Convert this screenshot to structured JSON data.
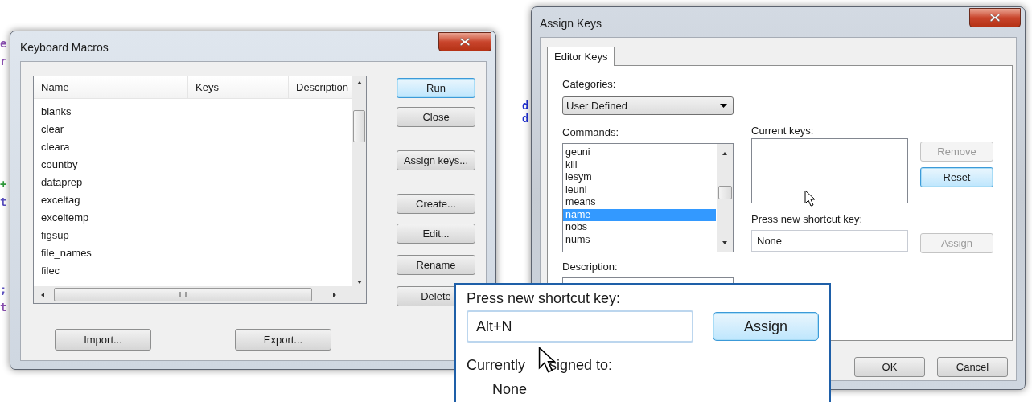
{
  "editor_fragments": [
    {
      "text": "e",
      "color": "#8a4fb0"
    },
    {
      "text": "r",
      "color": "#8a4fb0"
    },
    {
      "text": "+",
      "color": "#2e9a3a"
    },
    {
      "text": "t",
      "color": "#5a4fc0"
    },
    {
      "text": ";",
      "color": "#5a4fc0"
    },
    {
      "text": "t",
      "color": "#8a4fb0"
    },
    {
      "text": "d",
      "color": "#1f2fd0"
    },
    {
      "text": "d",
      "color": "#1f2fd0"
    }
  ],
  "keyboard_macros": {
    "title": "Keyboard Macros",
    "columns": [
      "Name",
      "Keys",
      "Description"
    ],
    "rows": [
      "blanks",
      "clear",
      "cleara",
      "countby",
      "dataprep",
      "exceltag",
      "exceltemp",
      "figsup",
      "file_names",
      "filec"
    ],
    "buttons": [
      {
        "label": "Run",
        "default": true
      },
      {
        "label": "Close",
        "default": false
      },
      {
        "label": "Assign keys...",
        "default": false
      },
      {
        "label": "Create...",
        "default": false
      },
      {
        "label": "Edit...",
        "default": false
      },
      {
        "label": "Rename",
        "default": false
      },
      {
        "label": "Delete",
        "default": false
      }
    ],
    "bottom_buttons": [
      {
        "label": "Import..."
      },
      {
        "label": "Export..."
      }
    ]
  },
  "assign_keys": {
    "title": "Assign Keys",
    "tabs": [
      {
        "label": "Editor Keys",
        "selected": true
      }
    ],
    "categories": {
      "label": "Categories:",
      "value": "User Defined"
    },
    "commands": {
      "label": "Commands:",
      "items": [
        {
          "label": "geuni",
          "selected": false
        },
        {
          "label": "kill",
          "selected": false
        },
        {
          "label": "lesym",
          "selected": false
        },
        {
          "label": "leuni",
          "selected": false
        },
        {
          "label": "means",
          "selected": false
        },
        {
          "label": "name",
          "selected": true
        },
        {
          "label": "nobs",
          "selected": false
        },
        {
          "label": "nums",
          "selected": false
        }
      ]
    },
    "description": {
      "label": "Description:"
    },
    "current_keys": {
      "label": "Current keys:"
    },
    "side_buttons": [
      {
        "label": "Remove",
        "disabled": true,
        "default": false
      },
      {
        "label": "Reset",
        "disabled": false,
        "default": true
      }
    ],
    "shortcut": {
      "label": "Press new shortcut key:",
      "value": "None"
    },
    "assign_button": {
      "label": "Assign",
      "disabled": true
    },
    "footer_buttons": [
      "OK",
      "Cancel"
    ]
  },
  "zoom_inset": {
    "shortcut_label": "Press new shortcut key:",
    "shortcut_value": "Alt+N",
    "assign_button": {
      "label": "Assign",
      "highlighted": true
    },
    "assigned_label_parts": [
      "Currently",
      "signed to:"
    ],
    "assigned_value": "None"
  }
}
